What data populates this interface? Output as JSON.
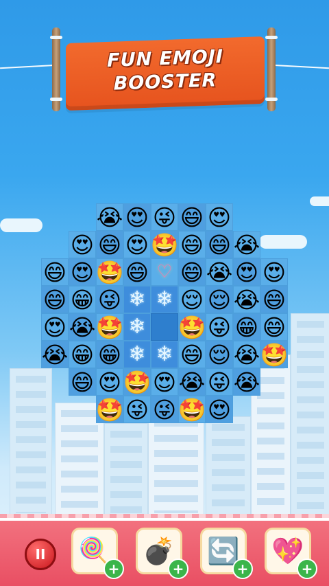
{
  "banner": {
    "title_line1": "FUN EMOJI",
    "title_line2": "BOOSTER"
  },
  "board": {
    "cols": 9,
    "rows": 8,
    "tiles": [
      {
        "r": 0,
        "c": 2,
        "e": "😭"
      },
      {
        "r": 0,
        "c": 3,
        "e": "😍"
      },
      {
        "r": 0,
        "c": 4,
        "e": "😜"
      },
      {
        "r": 0,
        "c": 5,
        "e": "😄"
      },
      {
        "r": 0,
        "c": 6,
        "e": "😍"
      },
      {
        "r": 1,
        "c": 1,
        "e": "😍"
      },
      {
        "r": 1,
        "c": 2,
        "e": "😄"
      },
      {
        "r": 1,
        "c": 3,
        "e": "😍"
      },
      {
        "r": 1,
        "c": 4,
        "e": "🤩"
      },
      {
        "r": 1,
        "c": 5,
        "e": "😄"
      },
      {
        "r": 1,
        "c": 6,
        "e": "😄"
      },
      {
        "r": 1,
        "c": 7,
        "e": "😭"
      },
      {
        "r": 2,
        "c": 0,
        "e": "😄"
      },
      {
        "r": 2,
        "c": 1,
        "e": "😍"
      },
      {
        "r": 2,
        "c": 2,
        "e": "🤩"
      },
      {
        "r": 2,
        "c": 3,
        "e": "😄"
      },
      {
        "r": 2,
        "c": 5,
        "e": "😄"
      },
      {
        "r": 2,
        "c": 6,
        "e": "😭"
      },
      {
        "r": 2,
        "c": 7,
        "e": "😍"
      },
      {
        "r": 2,
        "c": 8,
        "e": "😍"
      },
      {
        "r": 3,
        "c": 0,
        "e": "😄"
      },
      {
        "r": 3,
        "c": 1,
        "e": "😁"
      },
      {
        "r": 3,
        "c": 2,
        "e": "😜"
      },
      {
        "r": 3,
        "c": 5,
        "e": "😌"
      },
      {
        "r": 3,
        "c": 6,
        "e": "😌"
      },
      {
        "r": 3,
        "c": 7,
        "e": "😭"
      },
      {
        "r": 3,
        "c": 8,
        "e": "😄"
      },
      {
        "r": 4,
        "c": 0,
        "e": "😍"
      },
      {
        "r": 4,
        "c": 1,
        "e": "😭"
      },
      {
        "r": 4,
        "c": 2,
        "e": "🤩"
      },
      {
        "r": 4,
        "c": 5,
        "e": "🤩"
      },
      {
        "r": 4,
        "c": 6,
        "e": "😜"
      },
      {
        "r": 4,
        "c": 7,
        "e": "😁"
      },
      {
        "r": 4,
        "c": 8,
        "e": "😄"
      },
      {
        "r": 5,
        "c": 0,
        "e": "😭"
      },
      {
        "r": 5,
        "c": 1,
        "e": "😁"
      },
      {
        "r": 5,
        "c": 2,
        "e": "😁"
      },
      {
        "r": 5,
        "c": 5,
        "e": "😄"
      },
      {
        "r": 5,
        "c": 6,
        "e": "😌"
      },
      {
        "r": 5,
        "c": 7,
        "e": "😭"
      },
      {
        "r": 5,
        "c": 8,
        "e": "🤩"
      },
      {
        "r": 6,
        "c": 1,
        "e": "😄"
      },
      {
        "r": 6,
        "c": 2,
        "e": "😍"
      },
      {
        "r": 6,
        "c": 3,
        "e": "🤩"
      },
      {
        "r": 6,
        "c": 4,
        "e": "😍"
      },
      {
        "r": 6,
        "c": 5,
        "e": "😭"
      },
      {
        "r": 6,
        "c": 6,
        "e": "😜"
      },
      {
        "r": 6,
        "c": 7,
        "e": "😭"
      },
      {
        "r": 7,
        "c": 2,
        "e": "🤩"
      },
      {
        "r": 7,
        "c": 3,
        "e": "😜"
      },
      {
        "r": 7,
        "c": 4,
        "e": "😜"
      },
      {
        "r": 7,
        "c": 5,
        "e": "🤩"
      },
      {
        "r": 7,
        "c": 6,
        "e": "😍"
      }
    ],
    "ice": [
      {
        "r": 3,
        "c": 3
      },
      {
        "r": 3,
        "c": 4
      },
      {
        "r": 4,
        "c": 3
      },
      {
        "r": 5,
        "c": 3
      },
      {
        "r": 5,
        "c": 4
      }
    ],
    "empty_blue": [
      {
        "r": 4,
        "c": 4
      }
    ],
    "special": {
      "r": 2,
      "c": 4,
      "e": "♡"
    }
  },
  "toolbar": {
    "pause_icon": "pause-icon",
    "tools": [
      {
        "name": "lollipop",
        "icon": "🍭"
      },
      {
        "name": "bomb",
        "icon": "💣"
      },
      {
        "name": "swap",
        "icon": "🔄"
      },
      {
        "name": "heart",
        "icon": "💖"
      }
    ],
    "plus_label": "+",
    "pause_label": "II"
  },
  "colors": {
    "sky": "#3aa7ef",
    "banner": "#e6531e",
    "bar": "#e94f63",
    "plus": "#3bb54a"
  }
}
